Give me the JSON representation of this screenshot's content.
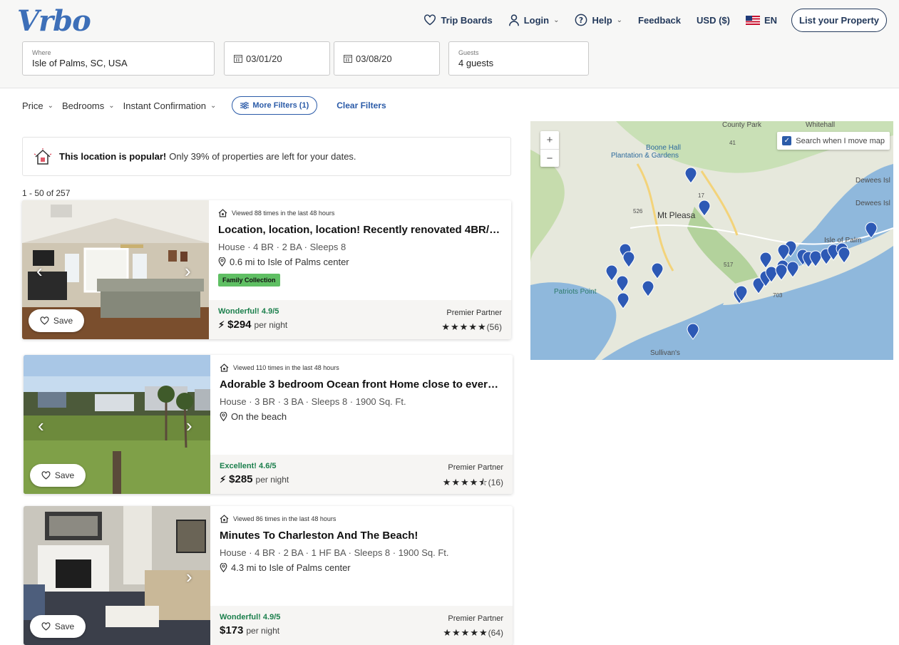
{
  "header": {
    "logo": "Vrbo",
    "nav": {
      "trip_boards": "Trip Boards",
      "login": "Login",
      "help": "Help",
      "feedback": "Feedback",
      "currency": "USD ($)",
      "language": "EN",
      "list_property": "List your Property"
    }
  },
  "search": {
    "where_label": "Where",
    "where_value": "Isle of Palms, SC, USA",
    "checkin": "03/01/20",
    "checkout": "03/08/20",
    "guests_label": "Guests",
    "guests_value": "4 guests"
  },
  "filters": {
    "price": "Price",
    "bedrooms": "Bedrooms",
    "instant": "Instant Confirmation",
    "more": "More Filters (1)",
    "clear": "Clear Filters"
  },
  "banner": {
    "bold": "This location is popular!",
    "text": "Only 39% of properties are left for your dates."
  },
  "results_count": "1 - 50 of 257",
  "listings": [
    {
      "views": "Viewed 88 times in the last 48 hours",
      "title": "Location, location, location! Recently renovated 4BR/2B...",
      "specs": "House · 4 BR · 2 BA · Sleeps 8",
      "distance": "0.6 mi to Isle of Palms center",
      "badge": "Family Collection",
      "rating": "Wonderful! 4.9/5",
      "price": "$294",
      "per": "per night",
      "partner": "Premier Partner",
      "stars": "★★★★★",
      "reviews": "(56)",
      "save": "Save"
    },
    {
      "views": "Viewed 110 times in the last 48 hours",
      "title": "Adorable 3 bedroom Ocean front Home close to everyth...",
      "specs": "House · 3 BR · 3 BA · Sleeps 8 · 1900 Sq. Ft.",
      "distance": "On the beach",
      "rating": "Excellent! 4.6/5",
      "price": "$285",
      "per": "per night",
      "partner": "Premier Partner",
      "stars": "★★★★⯪",
      "reviews": "(16)",
      "save": "Save"
    },
    {
      "views": "Viewed 86 times in the last 48 hours",
      "title": "Minutes To Charleston And The Beach!",
      "specs": "House · 4 BR · 2 BA · 1 HF BA · Sleeps 8 · 1900 Sq. Ft.",
      "distance": "4.3 mi to Isle of Palms center",
      "rating": "Wonderful! 4.9/5",
      "price": "$173",
      "per": "per night",
      "partner": "Premier Partner",
      "stars": "★★★★★",
      "reviews": "(64)",
      "save": "Save"
    }
  ],
  "map": {
    "search_move": "Search when I move map",
    "zoom_in": "+",
    "zoom_out": "−",
    "labels": {
      "county_park": "County Park",
      "whitehall": "Whitehall",
      "boone_hall": "Boone Hall",
      "plantation": "Plantation & Gardens",
      "dewees1": "Dewees Isl",
      "dewees2": "Dewees Isl",
      "mt_pleasant": "Mt Pleasa",
      "isle_of_palms": "Isle of Palm",
      "patriots_point": "Patriots Point",
      "sullivans": "Sullivan's",
      "road_17": "17",
      "road_41": "41",
      "road_517": "517",
      "road_703": "703",
      "road_526": "526"
    }
  },
  "colors": {
    "brand": "#3d6fb8",
    "nav_text": "#23395b",
    "link": "#2b5ba8",
    "rating_green": "#1b7f4c",
    "badge_green": "#5fbf63",
    "map_water": "#8fb8dc",
    "map_land": "#e8eadf",
    "pin": "#2d59b5"
  }
}
